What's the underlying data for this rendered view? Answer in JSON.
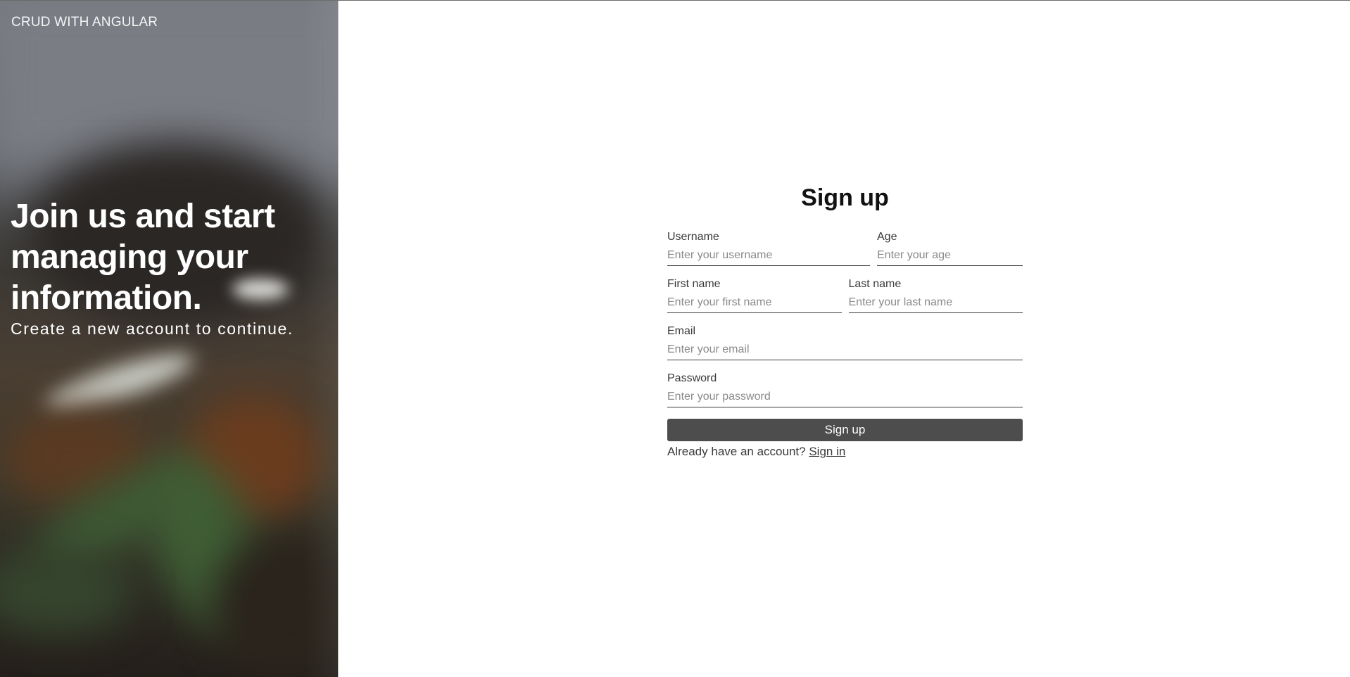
{
  "brand": "CRUD WITH ANGULAR",
  "hero": {
    "title": "Join us and start managing your information.",
    "subtitle": "Create a new account to continue."
  },
  "form": {
    "title": "Sign up",
    "username": {
      "label": "Username",
      "placeholder": "Enter your username",
      "value": ""
    },
    "age": {
      "label": "Age",
      "placeholder": "Enter your age",
      "value": ""
    },
    "first_name": {
      "label": "First name",
      "placeholder": "Enter your first name",
      "value": ""
    },
    "last_name": {
      "label": "Last name",
      "placeholder": "Enter your last name",
      "value": ""
    },
    "email": {
      "label": "Email",
      "placeholder": "Enter your email",
      "value": ""
    },
    "password": {
      "label": "Password",
      "placeholder": "Enter your password",
      "value": ""
    },
    "submit_label": "Sign up",
    "signin_prompt": "Already have an account?",
    "signin_link": "Sign in"
  },
  "colors": {
    "button_bg": "#4d4d4d",
    "text": "#333333",
    "placeholder": "#8a8a8a"
  }
}
